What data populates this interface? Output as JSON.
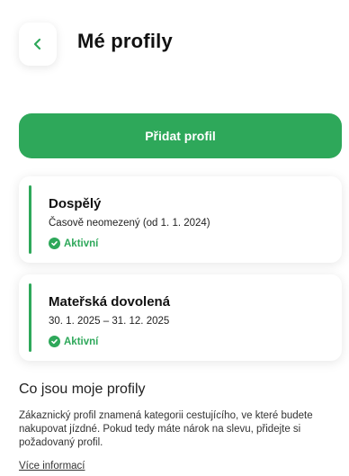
{
  "header": {
    "title": "Mé profily",
    "back_icon": "chevron-left-icon"
  },
  "add_button": {
    "label": "Přidat profil"
  },
  "profiles": [
    {
      "name": "Dospělý",
      "validity": "Časově neomezený (od 1. 1. 2024)",
      "status": "Aktivní"
    },
    {
      "name": "Mateřská dovolená",
      "validity": "30. 1. 2025 – 31. 12. 2025",
      "status": "Aktivní"
    }
  ],
  "info": {
    "title": "Co jsou moje profily",
    "text": "Zákaznický profil znamená kategorii cestujícího, ve které budete nakupovat jízdné. Pokud tedy máte nárok na slevu, přidejte si požadovaný profil.",
    "link": "Více informací"
  },
  "colors": {
    "accent": "#2ea85a"
  }
}
